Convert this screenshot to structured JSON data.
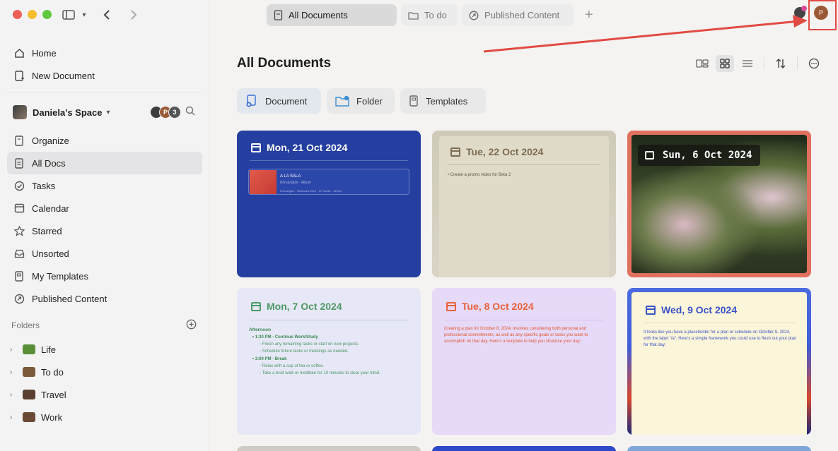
{
  "sidebar": {
    "top_items": [
      {
        "label": "Home",
        "icon": "home-icon"
      },
      {
        "label": "New Document",
        "icon": "new-doc-icon"
      }
    ],
    "space": {
      "name": "Daniela's Space",
      "member_initial": "P",
      "member_count": "3"
    },
    "items": [
      {
        "label": "Organize",
        "icon": "organize-icon"
      },
      {
        "label": "All Docs",
        "icon": "docs-icon",
        "active": true
      },
      {
        "label": "Tasks",
        "icon": "tasks-icon"
      },
      {
        "label": "Calendar",
        "icon": "calendar-icon"
      },
      {
        "label": "Starred",
        "icon": "star-icon"
      },
      {
        "label": "Unsorted",
        "icon": "inbox-icon"
      },
      {
        "label": "My Templates",
        "icon": "template-icon"
      },
      {
        "label": "Published Content",
        "icon": "publish-icon"
      }
    ],
    "folders_label": "Folders",
    "folders": [
      {
        "label": "Life",
        "color": "#5a8f3a"
      },
      {
        "label": "To do",
        "color": "#7a5a3a"
      },
      {
        "label": "Travel",
        "color": "#5a4030"
      },
      {
        "label": "Work",
        "color": "#6a4a35"
      }
    ]
  },
  "tabs": [
    {
      "label": "All Documents",
      "active": true
    },
    {
      "label": "To do"
    },
    {
      "label": "Published Content"
    }
  ],
  "user": {
    "initial": "P"
  },
  "main": {
    "title": "All Documents",
    "create_buttons": [
      "Document",
      "Folder",
      "Templates"
    ]
  },
  "cards": [
    {
      "date": "Mon, 21 Oct 2024",
      "embed_title": "A LA SALA",
      "embed_sub": "Khruangbin · Album",
      "embed_meta": "Khruangbin · Released 2024 · 12 Tracks · 38 min"
    },
    {
      "date": "Tue, 22 Oct 2024",
      "text": "Create a promo video for Beta 2"
    },
    {
      "date": "Sun, 6 Oct 2024"
    },
    {
      "date": "Mon, 7 Oct 2024",
      "heading": "Afternoon",
      "l1": "1:30 PM - Continue Work/Study",
      "l1a": "Finish any remaining tasks or start on new projects.",
      "l1b": "Schedule future tasks or meetings as needed.",
      "l2": "3:00 PM - Break",
      "l2a": "Relax with a cup of tea or coffee.",
      "l2b": "Take a brief walk or meditate for 10 minutes to clear your mind."
    },
    {
      "date": "Tue, 8 Oct 2024",
      "text": "Creating a plan for October 8, 2024, involves considering both personal and professional commitments, as well as any specific goals or tasks you want to accomplish on that day. Here's a template to help you structure your day:"
    },
    {
      "date": "Wed, 9 Oct 2024",
      "text": "It looks like you have a placeholder for a plan or schedule on October 9, 2024, with the label \"/a\". Here's a simple framework you could use to flesh out your plan for that day:"
    }
  ],
  "colors": {
    "accent_red": "#e14b44",
    "blue_card": "#2a43a3"
  }
}
